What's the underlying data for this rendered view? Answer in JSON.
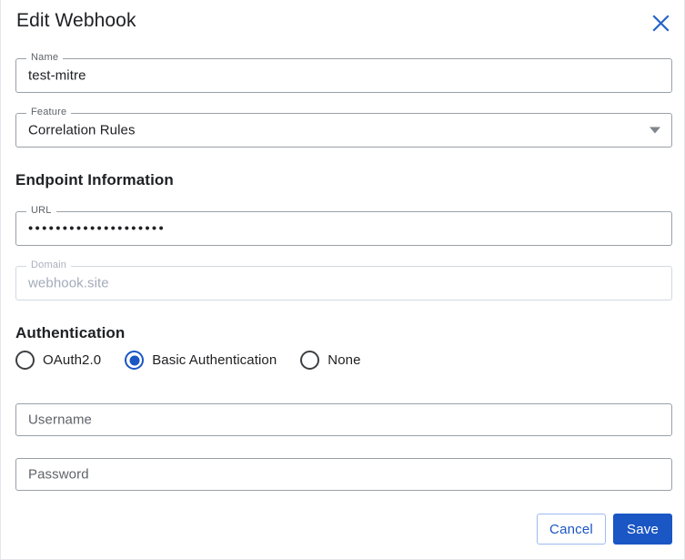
{
  "dialog": {
    "title": "Edit Webhook",
    "close_icon": "close-icon"
  },
  "form": {
    "name": {
      "label": "Name",
      "value": "test-mitre",
      "placeholder": ""
    },
    "feature": {
      "label": "Feature",
      "value": "Correlation Rules",
      "arrow_icon": "chevron-down-icon",
      "options": [
        "Correlation Rules"
      ]
    }
  },
  "endpoint_section": {
    "heading": "Endpoint Information",
    "url": {
      "label": "URL",
      "value": "••••••••••••••••••••",
      "masked": true
    },
    "domain": {
      "label": "Domain",
      "value": "webhook.site",
      "disabled": true
    }
  },
  "authentication_section": {
    "heading": "Authentication",
    "options": [
      {
        "label": "OAuth2.0",
        "selected": false
      },
      {
        "label": "Basic Authentication",
        "selected": true
      },
      {
        "label": "None",
        "selected": false
      }
    ],
    "username": {
      "placeholder": "Username",
      "value": ""
    },
    "password": {
      "placeholder": "Password",
      "value": ""
    }
  },
  "footer": {
    "cancel_label": "Cancel",
    "save_label": "Save"
  },
  "colors": {
    "accent_blue": "#1a56c4",
    "border_gray": "#9aa0a6",
    "disabled_gray": "#a3abba",
    "text_primary": "#202124",
    "text_secondary": "#5f6368"
  }
}
